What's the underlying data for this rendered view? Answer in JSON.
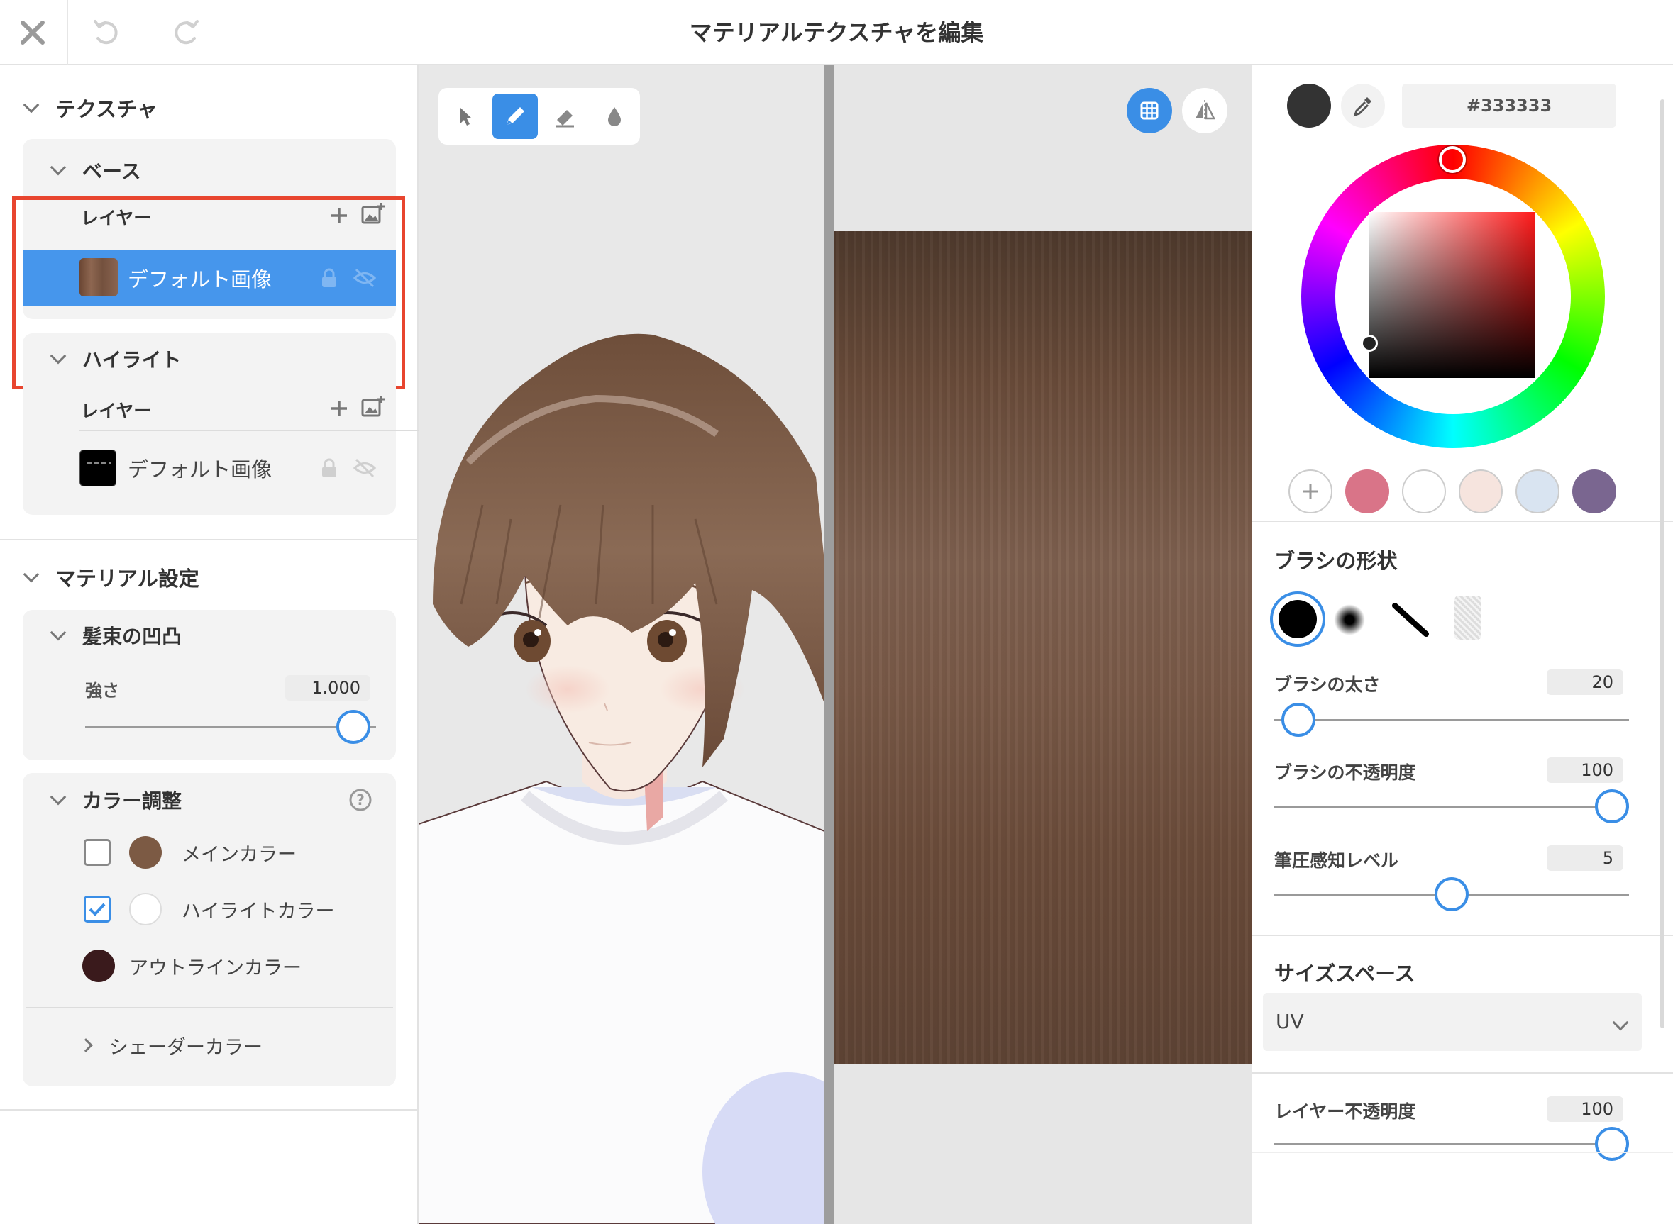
{
  "header": {
    "title": "マテリアルテクスチャを編集"
  },
  "left": {
    "texture_section": "テクスチャ",
    "base": {
      "title": "ベース",
      "layer_label": "レイヤー",
      "layer_name": "デフォルト画像"
    },
    "highlight": {
      "title": "ハイライト",
      "layer_label": "レイヤー",
      "layer_name": "デフォルト画像"
    },
    "material_section": "マテリアル設定",
    "bump": {
      "title": "髪束の凹凸",
      "strength_label": "強さ",
      "strength_value": "1.000",
      "strength_level": 1.0
    },
    "color_adjust": {
      "title": "カラー調整",
      "items": [
        {
          "label": "メインカラー",
          "checked": false,
          "color": "#7c5a44"
        },
        {
          "label": "ハイライトカラー",
          "checked": true,
          "color": "#ffffff"
        },
        {
          "label": "アウトラインカラー",
          "checked": null,
          "color": "#3a1a1c"
        }
      ],
      "shader_color": "シェーダーカラー"
    }
  },
  "tools": [
    "select-tool",
    "pen-tool",
    "eraser-tool",
    "fill-tool"
  ],
  "right": {
    "hex_value": "#333333",
    "current_color": "#333333",
    "presets": [
      "#d97488",
      "#ffffff",
      "#f6e4de",
      "#d9e4f1",
      "#7a6690"
    ],
    "brush_shape": {
      "title": "ブラシの形状"
    },
    "brush_size": {
      "label": "ブラシの太さ",
      "value": "20",
      "level": 0.1
    },
    "brush_opacity": {
      "label": "ブラシの不透明度",
      "value": "100",
      "level": 1.0
    },
    "pressure": {
      "label": "筆圧感知レベル",
      "value": "5",
      "level": 0.5
    },
    "size_space": {
      "title": "サイズスペース",
      "selected": "UV"
    },
    "layer_opacity": {
      "label": "レイヤー不透明度",
      "value": "100",
      "level": 1.0
    }
  },
  "colors": {
    "accent": "#3a8ee6",
    "highlight_border": "#e8452f"
  }
}
